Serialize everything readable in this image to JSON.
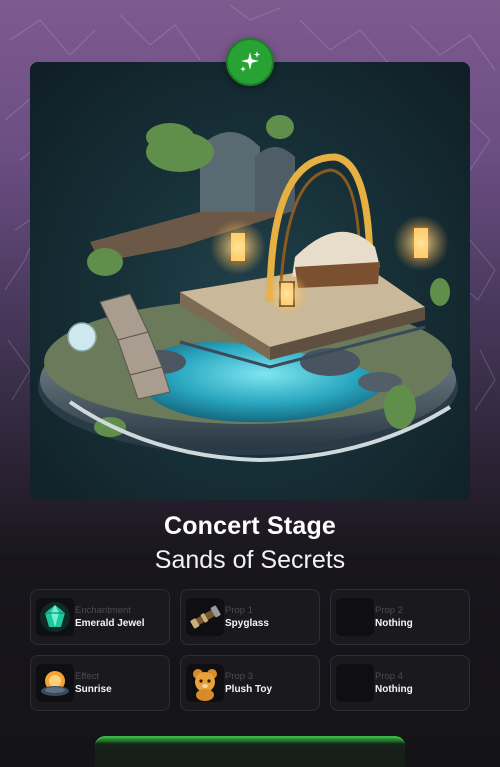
{
  "item": {
    "title": "Concert Stage",
    "subtitle": "Sands of Secrets",
    "badge_icon": "sparkles-icon",
    "badge_color": "#27a334"
  },
  "slots": [
    {
      "label": "Enchantment",
      "value": "Emerald Jewel",
      "icon": "emerald-jewel-icon"
    },
    {
      "label": "Prop 1",
      "value": "Spyglass",
      "icon": "spyglass-icon"
    },
    {
      "label": "Prop 2",
      "value": "Nothing",
      "icon": "empty-slot-icon"
    },
    {
      "label": "Effect",
      "value": "Sunrise",
      "icon": "sunrise-icon"
    },
    {
      "label": "Prop 3",
      "value": "Plush Toy",
      "icon": "plush-toy-icon"
    },
    {
      "label": "Prop 4",
      "value": "Nothing",
      "icon": "empty-slot-icon"
    }
  ],
  "colors": {
    "accent": "#27a334",
    "slot_border": "#2e2d33",
    "slot_label": "#4c4a52"
  }
}
